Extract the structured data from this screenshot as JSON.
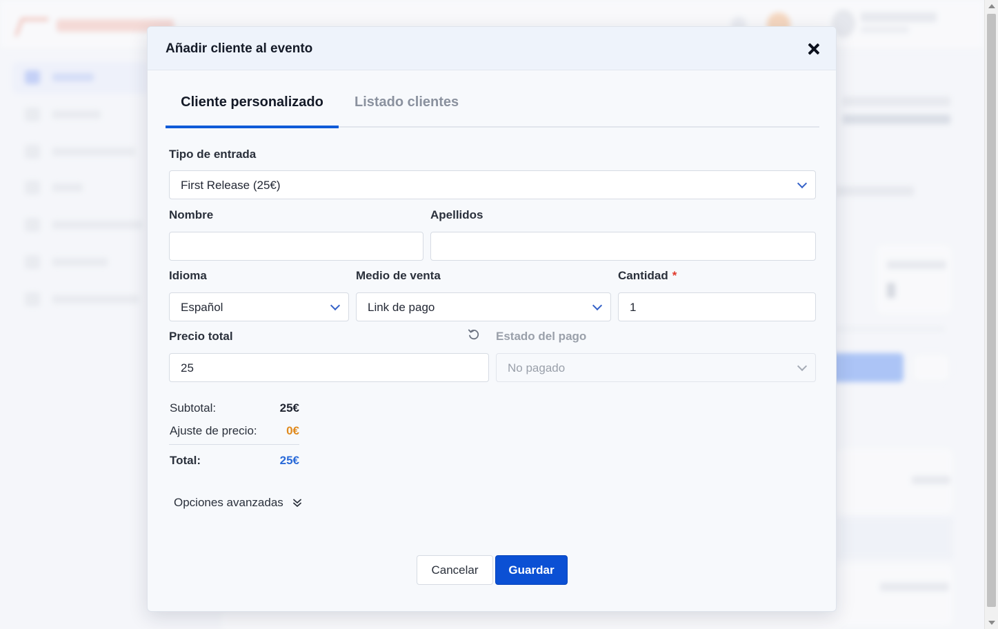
{
  "modal": {
    "title": "Añadir cliente al evento",
    "close_icon": "close-icon"
  },
  "tabs": [
    {
      "label": "Cliente personalizado",
      "active": true
    },
    {
      "label": "Listado clientes",
      "active": false
    }
  ],
  "form": {
    "ticket_type": {
      "label": "Tipo de entrada",
      "value": "First Release (25€)"
    },
    "first_name": {
      "label": "Nombre",
      "value": ""
    },
    "last_name": {
      "label": "Apellidos",
      "value": ""
    },
    "language": {
      "label": "Idioma",
      "value": "Español"
    },
    "sales_channel": {
      "label": "Medio de venta",
      "value": "Link de pago"
    },
    "quantity": {
      "label": "Cantidad",
      "required_mark": "*",
      "value": "1"
    },
    "total_price": {
      "label": "Precio total",
      "value": "25",
      "reset_icon": "reset-icon"
    },
    "payment_status": {
      "label": "Estado del pago",
      "value": "No pagado",
      "disabled": true
    }
  },
  "summary": {
    "subtotal_label": "Subtotal:",
    "subtotal_value": "25€",
    "adjustment_label": "Ajuste de precio:",
    "adjustment_value": "0€",
    "total_label": "Total:",
    "total_value": "25€"
  },
  "advanced": {
    "label": "Opciones avanzadas",
    "icon": "chevron-double-down-icon"
  },
  "buttons": {
    "cancel": "Cancelar",
    "save": "Guardar"
  },
  "colors": {
    "primary": "#0b50d4",
    "tab_underline": "#0f5bd8",
    "adjustment": "#e08a1e",
    "total": "#2a6ad8",
    "required": "#e0392b"
  }
}
